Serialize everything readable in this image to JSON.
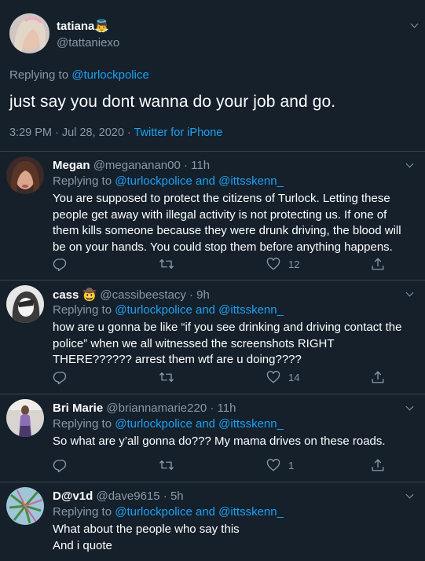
{
  "main_tweet": {
    "name": "tatiana",
    "name_emoji": "👼",
    "handle": "@tattaniexo",
    "replying_prefix": "Replying to",
    "replying_to": "@turlockpolice",
    "text": "just say you dont wanna do your job and go.",
    "time": "3:29 PM · Jul 28, 2020",
    "dot": " · ",
    "source": "Twitter for iPhone"
  },
  "replies": [
    {
      "name": "Megan",
      "handle": "@megananan00 · 11h",
      "replying_prefix": "Replying to",
      "replying_to": "@turlockpolice and @ittsskenn_",
      "text": "You are supposed to protect the citizens of Turlock. Letting these people get away with illegal activity is not protecting us. If one of them kills someone because they were drunk driving, the blood will be on your hands. You could stop them before anything happens.",
      "likes": "12"
    },
    {
      "name": "cass",
      "name_emoji": "🤠",
      "handle": "@cassibeestacy · 9h",
      "replying_prefix": "Replying to",
      "replying_to": "@turlockpolice and @ittsskenn_",
      "text": "how are u gonna be like “if you see drinking and driving contact the police” when we all witnessed the screenshots RIGHT THERE?????? arrest them wtf are u doing????",
      "likes": "14"
    },
    {
      "name": "Bri Marie",
      "handle": "@briannamarie220 · 11h",
      "replying_prefix": "Replying to",
      "replying_to": "@turlockpolice and @ittsskenn_",
      "text": "So what are y’all gonna do??? My mama drives on these roads.",
      "likes": "1"
    },
    {
      "name": "D@v1d",
      "handle": "@dave9615 · 5h",
      "replying_prefix": "Replying to",
      "replying_to": "@turlockpolice and @ittsskenn_",
      "text_line1": "What about the people who say this",
      "text_line2": "And i quote"
    }
  ],
  "colors": {
    "background": "#15202b",
    "divider": "#38444d",
    "muted": "#8899a6",
    "link": "#1da1f2",
    "text": "#ffffff"
  },
  "icons": [
    "reply-icon",
    "retweet-icon",
    "like-icon",
    "share-icon",
    "chevron-down-icon"
  ]
}
